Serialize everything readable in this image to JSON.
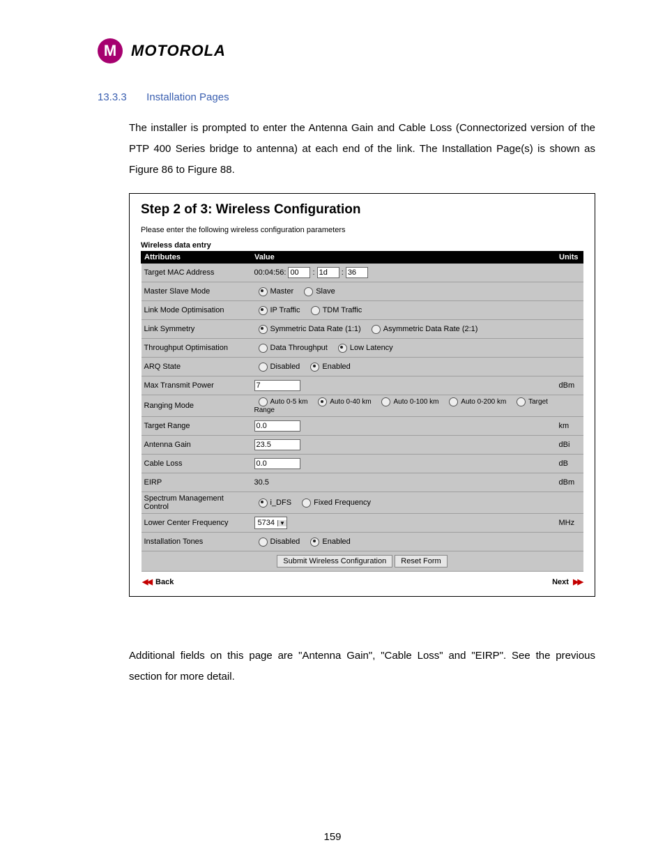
{
  "brand": "MOTOROLA",
  "section": {
    "number": "13.3.3",
    "title": "Installation Pages"
  },
  "intro": "The installer is prompted to enter the Antenna Gain and Cable Loss (Connectorized version of the PTP 400 Series bridge to antenna) at each end of the link. The Installation Page(s) is shown as Figure 86 to Figure 88.",
  "figure": {
    "title": "Step 2 of 3: Wireless Configuration",
    "sub": "Please enter the following wireless configuration parameters",
    "entry_heading": "Wireless data entry",
    "headers": {
      "attr": "Attributes",
      "value": "Value",
      "units": "Units"
    },
    "rows": {
      "target_mac": {
        "label": "Target MAC Address",
        "prefix": "00:04:56:",
        "v1": "00",
        "v2": "1d",
        "v3": "36",
        "sep": ":"
      },
      "master_slave": {
        "label": "Master Slave Mode",
        "opts": [
          "Master",
          "Slave"
        ],
        "sel": 0
      },
      "link_mode": {
        "label": "Link Mode Optimisation",
        "opts": [
          "IP Traffic",
          "TDM Traffic"
        ],
        "sel": 0
      },
      "link_sym": {
        "label": "Link Symmetry",
        "opts": [
          "Symmetric Data Rate (1:1)",
          "Asymmetric Data Rate (2:1)"
        ],
        "sel": 0
      },
      "throughput": {
        "label": "Throughput Optimisation",
        "opts": [
          "Data Throughput",
          "Low Latency"
        ],
        "sel": 1
      },
      "arq": {
        "label": "ARQ State",
        "opts": [
          "Disabled",
          "Enabled"
        ],
        "sel": 1
      },
      "max_tx": {
        "label": "Max Transmit Power",
        "value": "7",
        "units": "dBm"
      },
      "ranging": {
        "label": "Ranging Mode",
        "opts": [
          "Auto 0-5 km",
          "Auto 0-40 km",
          "Auto 0-100 km",
          "Auto 0-200 km",
          "Target Range"
        ],
        "sel": 1
      },
      "target_range": {
        "label": "Target Range",
        "value": "0.0",
        "units": "km"
      },
      "antenna_gain": {
        "label": "Antenna Gain",
        "value": "23.5",
        "units": "dBi"
      },
      "cable_loss": {
        "label": "Cable Loss",
        "value": "0.0",
        "units": "dB"
      },
      "eirp": {
        "label": "EIRP",
        "value": "30.5",
        "units": "dBm"
      },
      "smc": {
        "label": "Spectrum Management Control",
        "opts": [
          "i_DFS",
          "Fixed Frequency"
        ],
        "sel": 0
      },
      "lcf": {
        "label": "Lower Center Frequency",
        "value": "5734",
        "units": "MHz"
      },
      "install_tones": {
        "label": "Installation Tones",
        "opts": [
          "Disabled",
          "Enabled"
        ],
        "sel": 1
      }
    },
    "buttons": {
      "submit": "Submit Wireless Configuration",
      "reset": "Reset Form"
    },
    "nav": {
      "back": "Back",
      "next": "Next"
    }
  },
  "outro": "Additional fields on this page are \"Antenna Gain\", \"Cable Loss\" and \"EIRP\". See the previous section for more detail.",
  "page_number": "159"
}
